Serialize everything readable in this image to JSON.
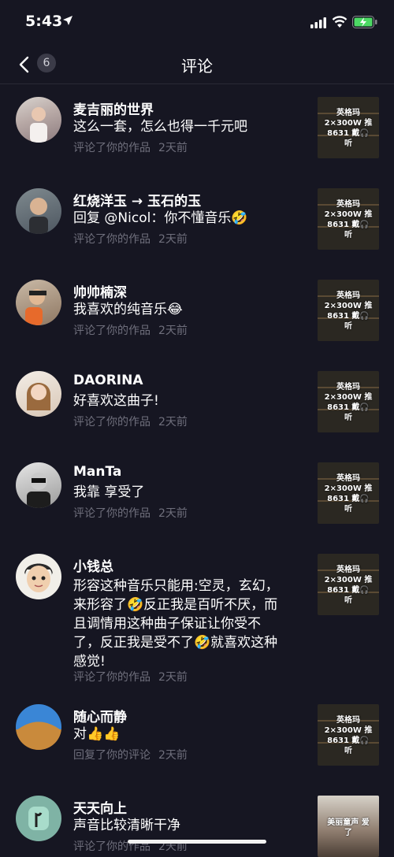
{
  "status": {
    "time": "5:43"
  },
  "nav": {
    "title": "评论",
    "badge": "6"
  },
  "items": [
    {
      "name": "麦吉丽的世界",
      "comment": "这么一套，怎么也得一千元吧",
      "action": "评论了你的作品",
      "time": "2天前",
      "thumb": "英格玛 2×300W 推8631 戴🎧听"
    },
    {
      "name": "红烧洋玉 → 玉石的玉",
      "comment": "回复 @Nicol：你不懂音乐🤣",
      "action": "评论了你的作品",
      "time": "2天前",
      "thumb": "英格玛 2×300W 推8631 戴🎧听"
    },
    {
      "name": "帅帅楠深",
      "comment": "我喜欢的纯音乐😂",
      "action": "评论了你的作品",
      "time": "2天前",
      "thumb": "英格玛 2×300W 推8631 戴🎧听"
    },
    {
      "name": "DAORINA",
      "comment": "好喜欢这曲子!",
      "action": "评论了你的作品",
      "time": "2天前",
      "thumb": "英格玛 2×300W 推8631 戴🎧听"
    },
    {
      "name": "ManTa",
      "comment": "我靠 享受了",
      "action": "评论了你的作品",
      "time": "2天前",
      "thumb": "英格玛 2×300W 推8631 戴🎧听"
    },
    {
      "name": "小钱总",
      "comment": "形容这种音乐只能用:空灵，玄幻，来形容了🤣反正我是百听不厌，而且调情用这种曲子保证让你受不了，反正我是受不了🤣就喜欢这种感觉!",
      "action": "评论了你的作品",
      "time": "2天前",
      "thumb": "英格玛 2×300W 推8631 戴🎧听"
    },
    {
      "name": "随心而静",
      "comment": "对👍👍",
      "action": "回复了你的评论",
      "time": "2天前",
      "thumb": "英格玛 2×300W 推8631 戴🎧听"
    },
    {
      "name": "天天向上",
      "comment": "声音比较清晰干净",
      "action": "评论了你的作品",
      "time": "2天前",
      "thumb": "美丽童声 爱了"
    }
  ]
}
